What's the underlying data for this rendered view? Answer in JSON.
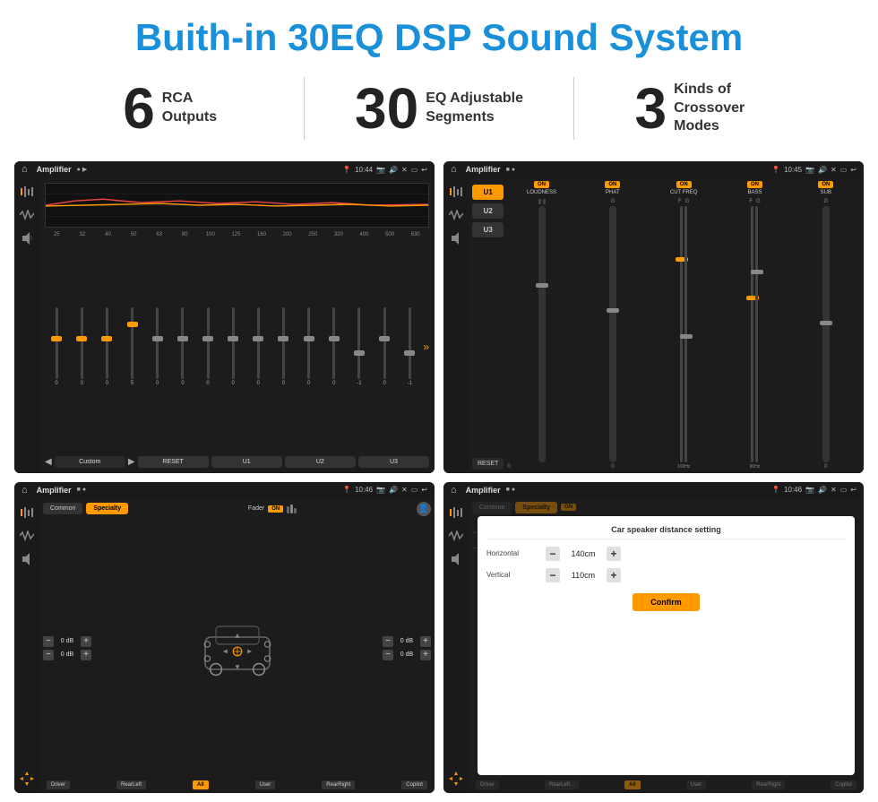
{
  "header": {
    "title": "Buith-in 30EQ DSP Sound System"
  },
  "stats": [
    {
      "number": "6",
      "label": "RCA\nOutputs"
    },
    {
      "number": "30",
      "label": "EQ Adjustable\nSegments"
    },
    {
      "number": "3",
      "label": "Kinds of\nCrossover Modes"
    }
  ],
  "screens": [
    {
      "id": "screen1",
      "title": "Amplifier",
      "time": "10:44",
      "type": "eq",
      "frequencies": [
        "25",
        "32",
        "40",
        "50",
        "63",
        "80",
        "100",
        "125",
        "160",
        "200",
        "250",
        "320",
        "400",
        "500",
        "630"
      ],
      "values": [
        "0",
        "0",
        "0",
        "5",
        "0",
        "0",
        "0",
        "0",
        "0",
        "0",
        "0",
        "0",
        "-1",
        "0",
        "-1"
      ],
      "buttons": [
        "Custom",
        "RESET",
        "U1",
        "U2",
        "U3"
      ]
    },
    {
      "id": "screen2",
      "title": "Amplifier",
      "time": "10:45",
      "type": "amp2",
      "uButtons": [
        "U1",
        "U2",
        "U3"
      ],
      "controls": [
        {
          "label": "LOUDNESS",
          "on": true
        },
        {
          "label": "PHAT",
          "on": true
        },
        {
          "label": "CUT FREQ",
          "on": true
        },
        {
          "label": "BASS",
          "on": true
        },
        {
          "label": "SUB",
          "on": true
        }
      ],
      "resetLabel": "RESET"
    },
    {
      "id": "screen3",
      "title": "Amplifier",
      "time": "10:46",
      "type": "amp3",
      "tabs": [
        "Common",
        "Specialty"
      ],
      "faderLabel": "Fader",
      "volumeRows": [
        {
          "val": "0 dB"
        },
        {
          "val": "0 dB"
        },
        {
          "val": "0 dB"
        },
        {
          "val": "0 dB"
        }
      ],
      "bottomLabels": [
        "Driver",
        "RearLeft",
        "All",
        "User",
        "RearRight",
        "Copilot"
      ]
    },
    {
      "id": "screen4",
      "title": "Amplifier",
      "time": "10:46",
      "type": "amp4",
      "tabs": [
        "Common",
        "Specialty"
      ],
      "dialog": {
        "title": "Car speaker distance setting",
        "rows": [
          {
            "label": "Horizontal",
            "value": "140cm"
          },
          {
            "label": "Vertical",
            "value": "110cm"
          }
        ],
        "confirmLabel": "Confirm"
      }
    }
  ]
}
